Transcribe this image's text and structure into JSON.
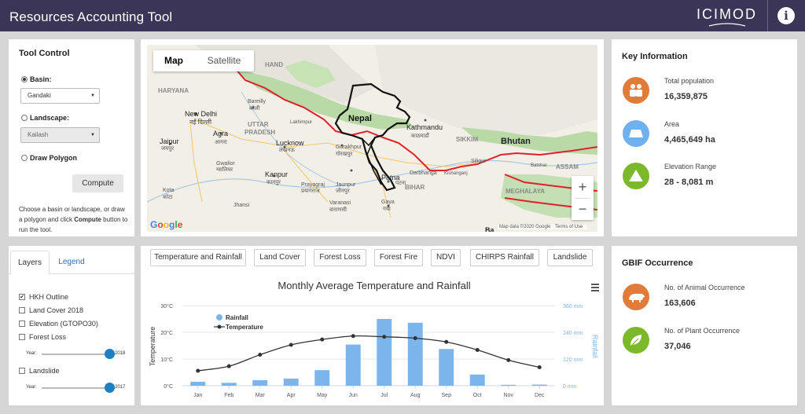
{
  "header": {
    "title": "Resources Accounting Tool",
    "logo_text": "ICIMOD",
    "info_icon": "info-icon"
  },
  "tool_control": {
    "title": "Tool Control",
    "basin_label": "Basin:",
    "basin_value": "Gandaki",
    "landscape_label": "Landscape:",
    "landscape_value": "Kailash",
    "draw_polygon_label": "Draw Polygon",
    "compute_label": "Compute",
    "help_text_1": "Choose a basin or landscape, or draw a polygon and click ",
    "help_bold": "Compute",
    "help_text_2": " button to run the tool.",
    "basin_selected": true
  },
  "map": {
    "tab_map": "Map",
    "tab_satellite": "Satellite",
    "zoom_in": "+",
    "zoom_out": "−",
    "google": "Google",
    "map_data": "Map data ©2020 Google",
    "terms": "Terms of Use",
    "labels": {
      "hand": "HAND",
      "haryana": "HARYANA",
      "uttar_pradesh_1": "UTTAR",
      "uttar_pradesh_2": "PRADESH",
      "new_delhi": "New Delhi",
      "new_delhi_hi": "नई दिल्ली",
      "bareilly": "Bareilly",
      "bareilly_hi": "बरेली",
      "agra": "Agra",
      "agra_hi": "आगरा",
      "jaipur": "Jaipur",
      "jaipur_hi": "जयपुर",
      "gwalior": "Gwalior",
      "gwalior_hi": "ग्वालियर",
      "lucknow": "Lucknow",
      "lucknow_hi": "लखनऊ",
      "lakhimpur": "Lakhimpur",
      "kanpur": "Kanpur",
      "kanpur_hi": "कानपुर",
      "kota": "Kota",
      "kota_hi": "कोटा",
      "jhansi": "Jhansi",
      "prayagraj": "Prayagraj",
      "prayagraj_hi": "प्रयागराज",
      "jaunpur": "Jaunpur",
      "jaunpur_hi": "जौनपुर",
      "varanasi": "Varanasi",
      "varanasi_hi": "वाराणसी",
      "gorakhpur": "Gorakhpur",
      "gorakhpur_hi": "गोरखपुर",
      "nepal": "Nepal",
      "kathmandu": "Kathmandu",
      "kathmandu_hi": "काठमाडौं",
      "patna": "Patna",
      "patna_hi": "पटना",
      "bihar": "BIHAR",
      "darbhanga": "Darbhanga",
      "kishanganj": "Kishanganj",
      "gaya": "Gaya",
      "gaya_hi": "गया",
      "sikkim": "SIKKIM",
      "bhutan": "Bhutan",
      "siliguri": "Siligur",
      "assam": "ASSAM",
      "batsar": "Batshar",
      "meghalaya": "MEGHALAYA",
      "ba": "Ba"
    }
  },
  "key_info": {
    "title": "Key Information",
    "items": [
      {
        "label": "Total population",
        "value": "16,359,875",
        "icon": "people-icon",
        "color": "#e07b39"
      },
      {
        "label": "Area",
        "value": "4,465,649 ha",
        "icon": "area-icon",
        "color": "#6fb0ef"
      },
      {
        "label": "Elevation Range",
        "value": "28 - 8,081 m",
        "icon": "mountain-icon",
        "color": "#7bb82a"
      }
    ]
  },
  "layers": {
    "tab_layers": "Layers",
    "tab_legend": "Legend",
    "items": [
      {
        "label": "HKH Outline",
        "checked": "✔"
      },
      {
        "label": "Land Cover 2018",
        "checked": ""
      },
      {
        "label": "Elevation (GTOPO30)",
        "checked": ""
      },
      {
        "label": "Forest Loss",
        "checked": ""
      },
      {
        "label": "Landslide",
        "checked": ""
      }
    ],
    "forest_year_label": "Year:",
    "forest_year_value": "2018",
    "landslide_year_label": "Year:",
    "landslide_year_value": "2017"
  },
  "chart_tabs": [
    "Temperature and Rainfall",
    "Land Cover",
    "Forest Loss",
    "Forest Fire",
    "NDVI",
    "CHIRPS Rainfall",
    "Landslide"
  ],
  "chart_data": {
    "type": "bar",
    "title": "Monthly Average Temperature and Rainfall",
    "categories": [
      "Jan",
      "Feb",
      "Mar",
      "Apr",
      "May",
      "Jun",
      "Jul",
      "Aug",
      "Sep",
      "Oct",
      "Nov",
      "Dec"
    ],
    "series": [
      {
        "name": "Rainfall",
        "type": "bar",
        "axis": "right",
        "color": "#7cb5ec",
        "values": [
          18,
          13,
          25,
          32,
          70,
          185,
          300,
          283,
          165,
          50,
          4,
          5
        ]
      },
      {
        "name": "Temperature",
        "type": "line",
        "axis": "left",
        "color": "#333333",
        "values": [
          5.6,
          7.3,
          11.6,
          15.3,
          17.3,
          18.6,
          18.3,
          17.8,
          16.4,
          13.4,
          9.6,
          6.9
        ]
      }
    ],
    "ylabel_left": "Temperature",
    "ylabel_right": "Rainfall",
    "ylim_left": [
      0,
      30
    ],
    "ylim_right": [
      0,
      360
    ],
    "yticks_left": [
      "0°C",
      "10°C",
      "20°C",
      "30°C"
    ],
    "yticks_right": [
      "0 mm",
      "120 mm",
      "240 mm",
      "360 mm"
    ],
    "grid": true,
    "legend": "top-left"
  },
  "gbif": {
    "title": "GBIF Occurrence",
    "items": [
      {
        "label": "No. of Animal Occurrence",
        "value": "163,606",
        "icon": "rhino-icon",
        "color": "#e07b39"
      },
      {
        "label": "No. of Plant Occurrence",
        "value": "37,046",
        "icon": "leaf-icon",
        "color": "#7bb82a"
      }
    ]
  }
}
